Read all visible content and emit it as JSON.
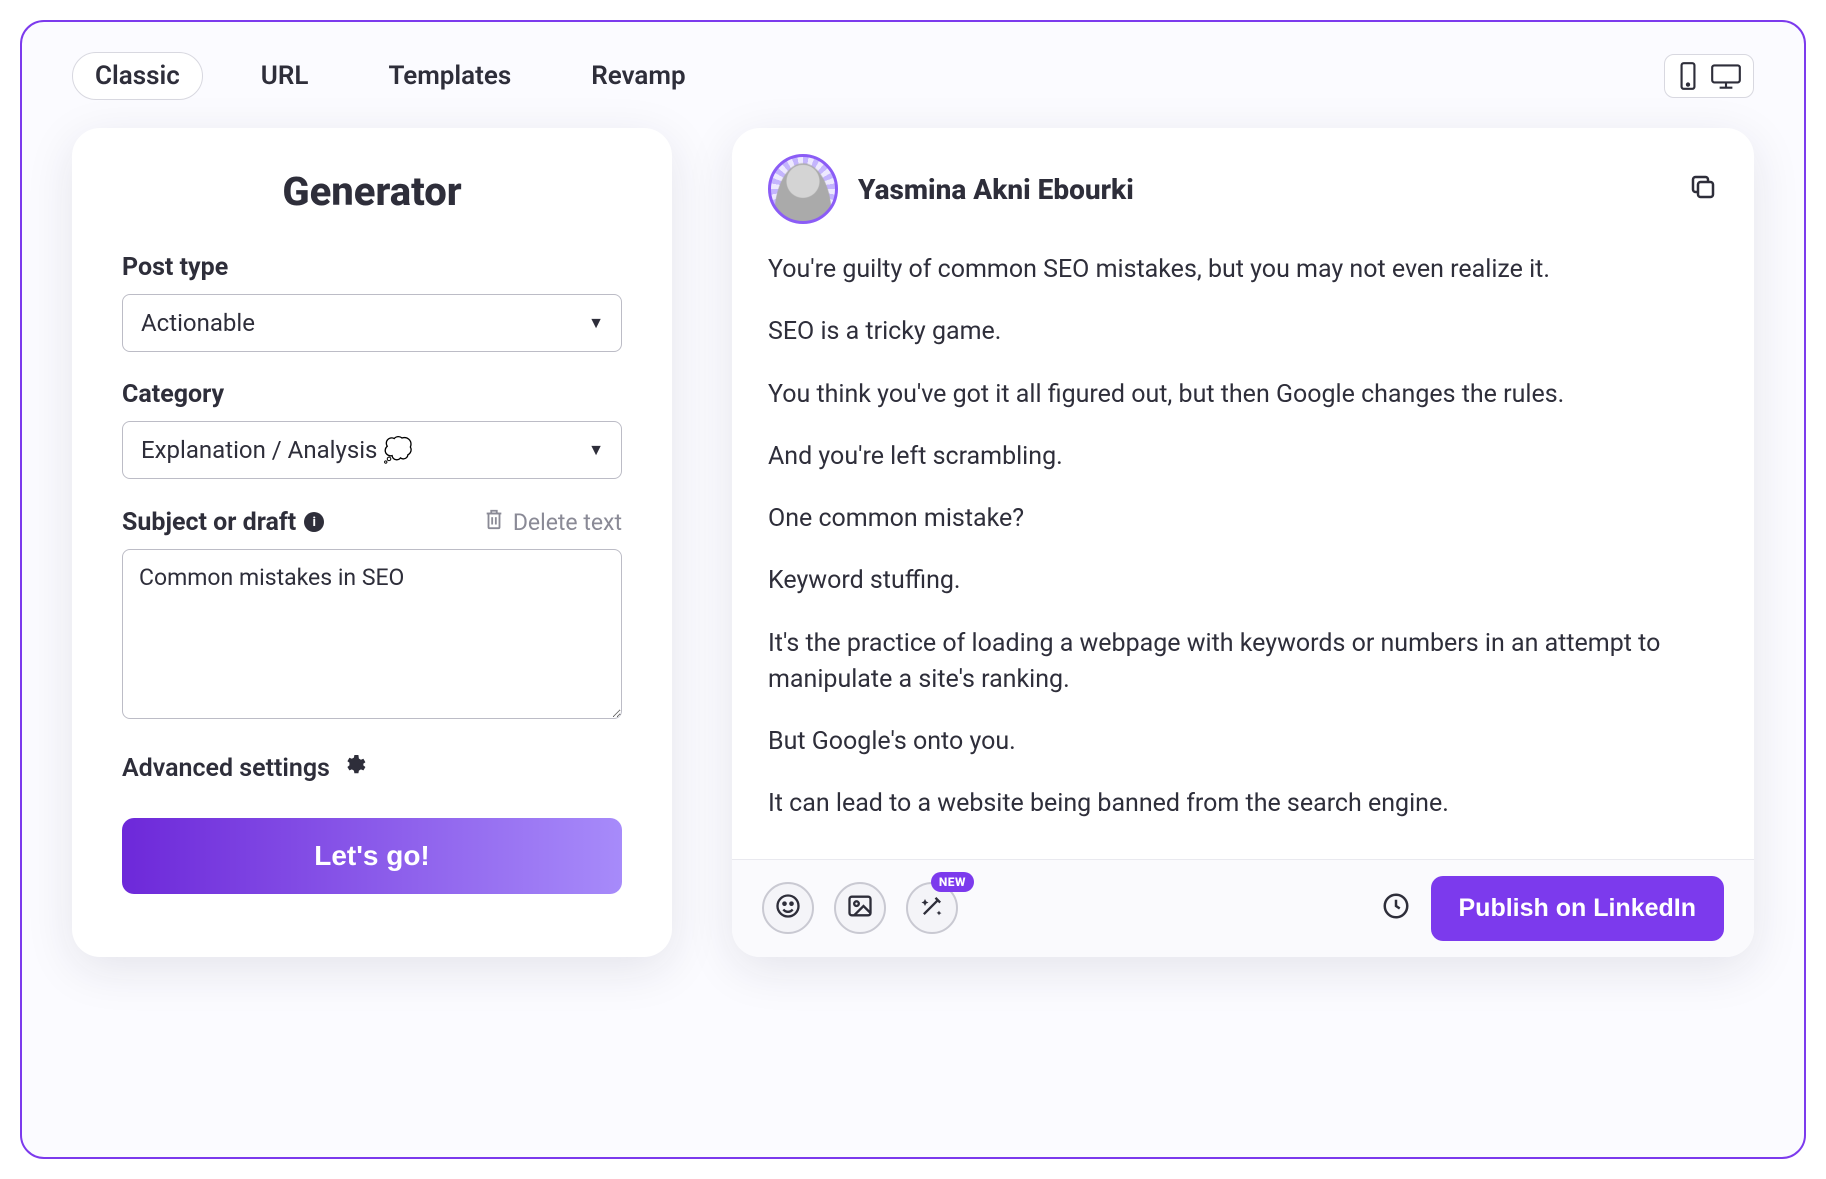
{
  "tabs": {
    "items": [
      {
        "label": "Classic",
        "active": true
      },
      {
        "label": "URL",
        "active": false
      },
      {
        "label": "Templates",
        "active": false
      },
      {
        "label": "Revamp",
        "active": false
      }
    ]
  },
  "generator": {
    "title": "Generator",
    "post_type_label": "Post type",
    "post_type_value": "Actionable",
    "category_label": "Category",
    "category_value": "Explanation / Analysis 💭",
    "subject_label": "Subject or draft",
    "delete_text_label": "Delete text",
    "subject_value": "Common mistakes in SEO",
    "advanced_label": "Advanced settings",
    "go_button": "Let's go!"
  },
  "preview": {
    "author": "Yasmina Akni Ebourki",
    "paragraphs": [
      "You're guilty of common SEO mistakes, but you may not even realize it.",
      "SEO is a tricky game.",
      "You think you've got it all figured out, but then Google changes the rules.",
      "And you're left scrambling.",
      "One common mistake?",
      "Keyword stuffing.",
      "It's the practice of loading a webpage with keywords or numbers in an attempt to manipulate a site's ranking.",
      "But Google's onto you.",
      "It can lead to a website being banned from the search engine."
    ],
    "new_badge": "NEW",
    "publish_label": "Publish on LinkedIn"
  }
}
